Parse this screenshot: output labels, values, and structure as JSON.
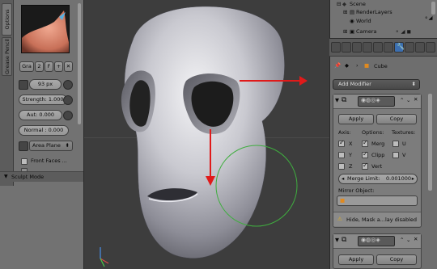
{
  "tool_shelf": {
    "vertical_tabs": [
      "Options",
      "Grease Pencil"
    ],
    "brush_icons": [
      "Gra",
      "2",
      "F"
    ],
    "radius_value": "93 px",
    "strength": "Strength: 1.000",
    "autosmooth": "Aut: 0.000",
    "normal": "Normal : 0.000",
    "sculpt_plane": "Area Plane",
    "front_faces": "Front Faces ...",
    "sculpt_mode_header": "Sculpt Mode"
  },
  "outliner": {
    "rows": [
      "Scene",
      "RenderLayers",
      "World",
      "Camera"
    ]
  },
  "properties": {
    "object_name": "Cube",
    "add_modifier": "Add Modifier",
    "mirror": {
      "apply": "Apply",
      "copy": "Copy",
      "axis_header": "Axis:",
      "options_header": "Options:",
      "textures_header": "Textures:",
      "axes": [
        "X",
        "Y",
        "Z"
      ],
      "options": [
        "Merg",
        "Clipp",
        "Vert"
      ],
      "textures": [
        "U",
        "V"
      ],
      "merge_limit_label": "Merge Limit:",
      "merge_limit_value": "0.001000",
      "mirror_object_label": "Mirror Object:"
    },
    "warning": "Hide, Mask a...lay disabled",
    "second_modifier": {
      "apply": "Apply",
      "copy": "Copy"
    }
  },
  "colors": {
    "arrow_red": "#e01a1a",
    "brush_circle": "#3fae3f",
    "active_tab": "#3c6fb0"
  }
}
